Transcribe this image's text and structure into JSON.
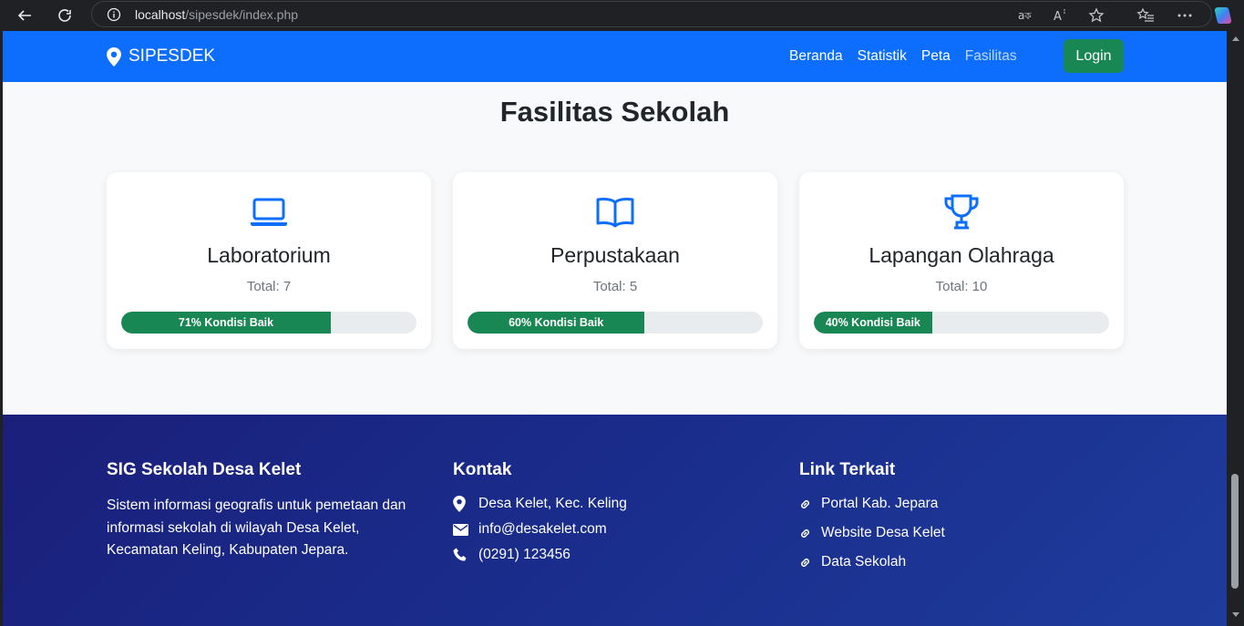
{
  "browser": {
    "url_host": "localhost",
    "url_path": "/sipesdek/index.php"
  },
  "navbar": {
    "brand": "SIPESDEK",
    "links": [
      "Beranda",
      "Statistik",
      "Peta",
      "Fasilitas"
    ],
    "login": "Login"
  },
  "section": {
    "title": "Fasilitas Sekolah",
    "cards": [
      {
        "icon": "laptop-icon",
        "title": "Laboratorium",
        "total": "Total: 7",
        "progress_label": "71% Kondisi Baik",
        "percent": 71
      },
      {
        "icon": "book-icon",
        "title": "Perpustakaan",
        "total": "Total: 5",
        "progress_label": "60% Kondisi Baik",
        "percent": 60
      },
      {
        "icon": "trophy-icon",
        "title": "Lapangan Olahraga",
        "total": "Total: 10",
        "progress_label": "40% Kondisi Baik",
        "percent": 40
      }
    ]
  },
  "footer": {
    "about_title": "SIG Sekolah Desa Kelet",
    "about_text": "Sistem informasi geografis untuk pemetaan dan informasi sekolah di wilayah Desa Kelet, Kecamatan Keling, Kabupaten Jepara.",
    "contact_title": "Kontak",
    "contacts": [
      {
        "icon": "map-pin-icon",
        "text": "Desa Kelet, Kec. Keling"
      },
      {
        "icon": "envelope-icon",
        "text": "info@desakelet.com"
      },
      {
        "icon": "phone-icon",
        "text": "(0291) 123456"
      }
    ],
    "links_title": "Link Terkait",
    "links": [
      "Portal Kab. Jepara",
      "Website Desa Kelet",
      "Data Sekolah"
    ]
  },
  "colors": {
    "primary": "#0d6efd",
    "success": "#198754",
    "footer": "#1a2d8c"
  }
}
